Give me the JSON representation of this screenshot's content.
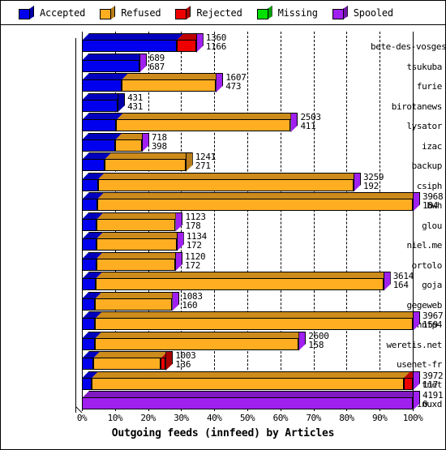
{
  "legend": {
    "items": [
      {
        "label": "Accepted",
        "color": "#0000ee",
        "icon": "cube-icon"
      },
      {
        "label": "Refused",
        "color": "#ffae21",
        "icon": "cube-icon"
      },
      {
        "label": "Rejected",
        "color": "#ee0000",
        "icon": "cube-icon"
      },
      {
        "label": "Missing",
        "color": "#00e000",
        "icon": "cube-icon"
      },
      {
        "label": "Spooled",
        "color": "#a020f0",
        "icon": "cube-icon"
      }
    ]
  },
  "chart_data": {
    "type": "bar",
    "orientation": "horizontal",
    "stacked": true,
    "title": "Outgoing feeds (innfeed) by Articles",
    "xlabel": "Outgoing feeds (innfeed) by Articles",
    "ylabel": "",
    "xlim": [
      0,
      100
    ],
    "xunit": "%",
    "grid": true,
    "legend_position": "top",
    "xticks": [
      "0%",
      "10%",
      "20%",
      "30%",
      "40%",
      "50%",
      "60%",
      "70%",
      "80%",
      "90%",
      "100%"
    ],
    "series": [
      {
        "name": "Accepted",
        "color": "#0000ee"
      },
      {
        "name": "Refused",
        "color": "#ffae21"
      },
      {
        "name": "Rejected",
        "color": "#ee0000"
      },
      {
        "name": "Missing",
        "color": "#00e000"
      },
      {
        "name": "Spooled",
        "color": "#a020f0"
      }
    ],
    "categories": [
      "bete-des-vosges",
      "tsukuba",
      "furie",
      "birotanews",
      "lysator",
      "izac",
      "backup",
      "csiph",
      "bwh",
      "glou",
      "niel.me",
      "ortolo",
      "goja",
      "gegeweb",
      "nntp4",
      "weretis.net",
      "usenet-fr",
      "tnet",
      "linuxd"
    ],
    "rows": [
      {
        "label": "bete-des-vosges",
        "value1": "1360",
        "value2": "1166",
        "total_pct": 34.5,
        "segments": [
          {
            "name": "Accepted",
            "pct": 28.6
          },
          {
            "name": "Rejected",
            "pct": 5.9
          }
        ]
      },
      {
        "label": "tsukuba",
        "value1": "689",
        "value2": "687",
        "total_pct": 17.4,
        "segments": [
          {
            "name": "Accepted",
            "pct": 17.4
          }
        ]
      },
      {
        "label": "furie",
        "value1": "1607",
        "value2": "473",
        "total_pct": 40.5,
        "segments": [
          {
            "name": "Accepted",
            "pct": 11.9
          },
          {
            "name": "Refused",
            "pct": 28.6
          }
        ]
      },
      {
        "label": "birotanews",
        "value1": "431",
        "value2": "431",
        "total_pct": 10.8,
        "segments": [
          {
            "name": "Accepted",
            "pct": 10.8
          }
        ]
      },
      {
        "label": "lysator",
        "value1": "2503",
        "value2": "411",
        "total_pct": 63.1,
        "segments": [
          {
            "name": "Accepted",
            "pct": 10.4
          },
          {
            "name": "Refused",
            "pct": 52.7
          }
        ]
      },
      {
        "label": "izac",
        "value1": "718",
        "value2": "398",
        "total_pct": 18.1,
        "segments": [
          {
            "name": "Accepted",
            "pct": 10.1
          },
          {
            "name": "Refused",
            "pct": 8.0
          }
        ]
      },
      {
        "label": "backup",
        "value1": "1241",
        "value2": "271",
        "total_pct": 31.3,
        "segments": [
          {
            "name": "Accepted",
            "pct": 6.8
          },
          {
            "name": "Refused",
            "pct": 24.5
          }
        ]
      },
      {
        "label": "csiph",
        "value1": "3259",
        "value2": "192",
        "total_pct": 82.1,
        "segments": [
          {
            "name": "Accepted",
            "pct": 4.8
          },
          {
            "name": "Refused",
            "pct": 77.3
          }
        ]
      },
      {
        "label": "bwh",
        "value1": "3968",
        "value2": "184",
        "total_pct": 100.0,
        "segments": [
          {
            "name": "Accepted",
            "pct": 4.6
          },
          {
            "name": "Refused",
            "pct": 95.4
          }
        ]
      },
      {
        "label": "glou",
        "value1": "1123",
        "value2": "178",
        "total_pct": 28.3,
        "segments": [
          {
            "name": "Accepted",
            "pct": 4.5
          },
          {
            "name": "Refused",
            "pct": 23.8
          }
        ]
      },
      {
        "label": "niel.me",
        "value1": "1134",
        "value2": "172",
        "total_pct": 28.6,
        "segments": [
          {
            "name": "Accepted",
            "pct": 4.3
          },
          {
            "name": "Refused",
            "pct": 24.3
          }
        ]
      },
      {
        "label": "ortolo",
        "value1": "1120",
        "value2": "172",
        "total_pct": 28.2,
        "segments": [
          {
            "name": "Accepted",
            "pct": 4.3
          },
          {
            "name": "Refused",
            "pct": 23.9
          }
        ]
      },
      {
        "label": "goja",
        "value1": "3614",
        "value2": "164",
        "total_pct": 91.1,
        "segments": [
          {
            "name": "Accepted",
            "pct": 4.1
          },
          {
            "name": "Refused",
            "pct": 87.0
          }
        ]
      },
      {
        "label": "gegeweb",
        "value1": "1083",
        "value2": "160",
        "total_pct": 27.3,
        "segments": [
          {
            "name": "Accepted",
            "pct": 4.0
          },
          {
            "name": "Refused",
            "pct": 23.3
          }
        ]
      },
      {
        "label": "nntp4",
        "value1": "3967",
        "value2": "159",
        "total_pct": 100.0,
        "segments": [
          {
            "name": "Accepted",
            "pct": 4.0
          },
          {
            "name": "Refused",
            "pct": 96.0
          }
        ]
      },
      {
        "label": "weretis.net",
        "value1": "2600",
        "value2": "158",
        "total_pct": 65.5,
        "segments": [
          {
            "name": "Accepted",
            "pct": 4.0
          },
          {
            "name": "Refused",
            "pct": 61.5
          }
        ]
      },
      {
        "label": "usenet-fr",
        "value1": "1003",
        "value2": "136",
        "total_pct": 25.3,
        "segments": [
          {
            "name": "Accepted",
            "pct": 3.4
          },
          {
            "name": "Refused",
            "pct": 20.4
          },
          {
            "name": "Rejected",
            "pct": 1.5
          }
        ]
      },
      {
        "label": "tnet",
        "value1": "3972",
        "value2": "117",
        "total_pct": 100.0,
        "segments": [
          {
            "name": "Accepted",
            "pct": 2.9
          },
          {
            "name": "Refused",
            "pct": 94.3
          },
          {
            "name": "Rejected",
            "pct": 2.8
          }
        ]
      },
      {
        "label": "linuxd",
        "value1": "4191",
        "value2": "0",
        "total_pct": 100.0,
        "segments": [
          {
            "name": "Spooled",
            "pct": 100.0
          }
        ]
      }
    ],
    "spooled_caps": {
      "bete-des-vosges": true,
      "tsukuba": true,
      "furie": true,
      "birotanews": false,
      "lysator": true,
      "izac": true,
      "backup": false,
      "csiph": true,
      "bwh": true,
      "glou": true,
      "niel.me": true,
      "ortolo": true,
      "goja": true,
      "gegeweb": true,
      "nntp4": true,
      "weretis.net": true,
      "usenet-fr": false,
      "tnet": true,
      "linuxd": true
    }
  }
}
